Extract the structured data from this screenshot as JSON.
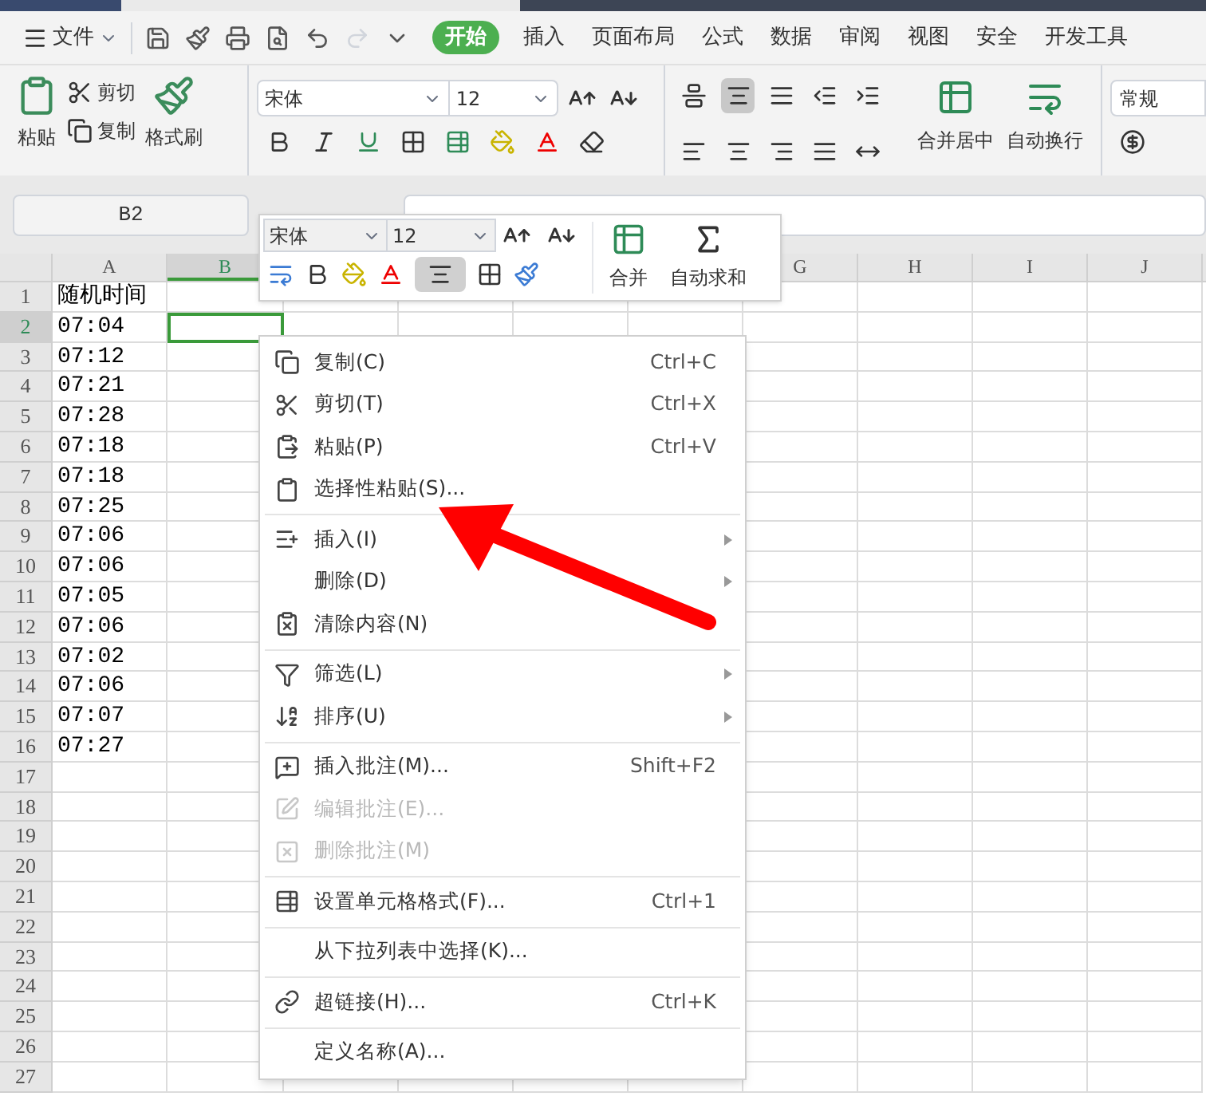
{
  "menu_bar": {
    "file_menu": "文件",
    "tabs": [
      {
        "label": "开始",
        "selected": true
      },
      {
        "label": "插入",
        "selected": false
      },
      {
        "label": "页面布局",
        "selected": false
      },
      {
        "label": "公式",
        "selected": false
      },
      {
        "label": "数据",
        "selected": false
      },
      {
        "label": "审阅",
        "selected": false
      },
      {
        "label": "视图",
        "selected": false
      },
      {
        "label": "安全",
        "selected": false
      },
      {
        "label": "开发工具",
        "selected": false
      }
    ]
  },
  "ribbon": {
    "paste": "粘贴",
    "cut": "剪切",
    "copy": "复制",
    "format_painter": "格式刷",
    "font_name": "宋体",
    "font_size": "12",
    "align_buttons": [
      {
        "selected": false
      },
      {
        "selected": true
      },
      {
        "selected": false
      },
      {
        "selected": false
      },
      {
        "selected": false
      }
    ],
    "merge": "合并居中",
    "wrap": "自动换行",
    "number_format": "常规"
  },
  "name_box": "B2",
  "mini_toolbar": {
    "font_name": "宋体",
    "font_size": "12",
    "merge": "合并",
    "autosum": "自动求和",
    "align_center_selected": true
  },
  "sheet": {
    "columns": [
      {
        "label": "A",
        "selected": false
      },
      {
        "label": "B",
        "selected": true
      },
      {
        "label": "G",
        "selected": false
      },
      {
        "label": "H",
        "selected": false
      },
      {
        "label": "I",
        "selected": false
      },
      {
        "label": "J",
        "selected": false
      }
    ],
    "rows": [
      {
        "number": "1",
        "selected": false,
        "cells": [
          "随机时间"
        ]
      },
      {
        "number": "2",
        "selected": true,
        "cells": [
          "07:04"
        ]
      },
      {
        "number": "3",
        "selected": false,
        "cells": [
          "07:12"
        ]
      },
      {
        "number": "4",
        "selected": false,
        "cells": [
          "07:21"
        ]
      },
      {
        "number": "5",
        "selected": false,
        "cells": [
          "07:28"
        ]
      },
      {
        "number": "6",
        "selected": false,
        "cells": [
          "07:18"
        ]
      },
      {
        "number": "7",
        "selected": false,
        "cells": [
          "07:18"
        ]
      },
      {
        "number": "8",
        "selected": false,
        "cells": [
          "07:25"
        ]
      },
      {
        "number": "9",
        "selected": false,
        "cells": [
          "07:06"
        ]
      },
      {
        "number": "10",
        "selected": false,
        "cells": [
          "07:06"
        ]
      },
      {
        "number": "11",
        "selected": false,
        "cells": [
          "07:05"
        ]
      },
      {
        "number": "12",
        "selected": false,
        "cells": [
          "07:06"
        ]
      },
      {
        "number": "13",
        "selected": false,
        "cells": [
          "07:02"
        ]
      },
      {
        "number": "14",
        "selected": false,
        "cells": [
          "07:06"
        ]
      },
      {
        "number": "15",
        "selected": false,
        "cells": [
          "07:07"
        ]
      },
      {
        "number": "16",
        "selected": false,
        "cells": [
          "07:27"
        ]
      },
      {
        "number": "17",
        "selected": false,
        "cells": []
      },
      {
        "number": "18",
        "selected": false,
        "cells": []
      },
      {
        "number": "19",
        "selected": false,
        "cells": []
      },
      {
        "number": "20",
        "selected": false,
        "cells": []
      },
      {
        "number": "21",
        "selected": false,
        "cells": []
      },
      {
        "number": "22",
        "selected": false,
        "cells": []
      },
      {
        "number": "23",
        "selected": false,
        "cells": []
      },
      {
        "number": "24",
        "selected": false,
        "cells": []
      },
      {
        "number": "25",
        "selected": false,
        "cells": []
      },
      {
        "number": "26",
        "selected": false,
        "cells": []
      },
      {
        "number": "27",
        "selected": false,
        "cells": []
      }
    ]
  },
  "context_menu": {
    "items": [
      {
        "kind": "item",
        "label": "复制(C)",
        "shortcut": "Ctrl+C",
        "disabled": false,
        "submenu": false
      },
      {
        "kind": "item",
        "label": "剪切(T)",
        "shortcut": "Ctrl+X",
        "disabled": false,
        "submenu": false
      },
      {
        "kind": "item",
        "label": "粘贴(P)",
        "shortcut": "Ctrl+V",
        "disabled": false,
        "submenu": false
      },
      {
        "kind": "item",
        "label": "选择性粘贴(S)...",
        "disabled": false,
        "submenu": false
      },
      {
        "kind": "separator"
      },
      {
        "kind": "item",
        "label": "插入(I)",
        "disabled": false,
        "submenu": true
      },
      {
        "kind": "item",
        "label": "删除(D)",
        "disabled": false,
        "submenu": true
      },
      {
        "kind": "item",
        "label": "清除内容(N)",
        "disabled": false,
        "submenu": false
      },
      {
        "kind": "separator"
      },
      {
        "kind": "item",
        "label": "筛选(L)",
        "disabled": false,
        "submenu": true
      },
      {
        "kind": "item",
        "label": "排序(U)",
        "disabled": false,
        "submenu": true
      },
      {
        "kind": "separator"
      },
      {
        "kind": "item",
        "label": "插入批注(M)...",
        "shortcut": "Shift+F2",
        "disabled": false,
        "submenu": false
      },
      {
        "kind": "item",
        "label": "编辑批注(E)...",
        "disabled": true,
        "submenu": false
      },
      {
        "kind": "item",
        "label": "删除批注(M)",
        "disabled": true,
        "submenu": false
      },
      {
        "kind": "separator"
      },
      {
        "kind": "item",
        "label": "设置单元格格式(F)...",
        "shortcut": "Ctrl+1",
        "disabled": false,
        "submenu": false
      },
      {
        "kind": "separator"
      },
      {
        "kind": "item",
        "label": "从下拉列表中选择(K)...",
        "disabled": false,
        "submenu": false
      },
      {
        "kind": "separator"
      },
      {
        "kind": "item",
        "label": "超链接(H)...",
        "shortcut": "Ctrl+K",
        "disabled": false,
        "submenu": false
      },
      {
        "kind": "separator"
      },
      {
        "kind": "item",
        "label": "定义名称(A)...",
        "disabled": false,
        "submenu": false
      }
    ]
  }
}
